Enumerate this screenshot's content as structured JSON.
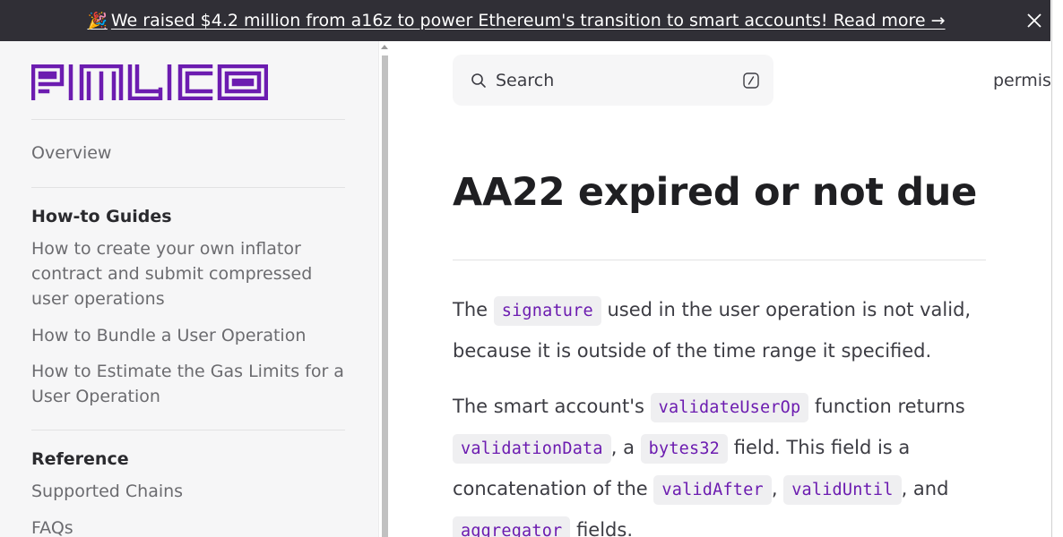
{
  "banner": {
    "emoji": "🎉",
    "text": "We raised $4.2 million from a16z to power Ethereum's transition to smart accounts! Read more →"
  },
  "brand": {
    "logo_text": "PIMLICO",
    "accent": "#6c1cb0"
  },
  "sidebar": {
    "overview": "Overview",
    "sections": [
      {
        "heading": "How-to Guides",
        "items": [
          "How to create your own inflator contract and submit compressed user operations",
          "How to Bundle a User Operation",
          "How to Estimate the Gas Limits for a User Operation"
        ]
      },
      {
        "heading": "Reference",
        "items": [
          "Supported Chains",
          "FAQs"
        ]
      }
    ]
  },
  "search": {
    "label": "Search"
  },
  "top_nav": {
    "partial_item": "permis"
  },
  "article": {
    "title": "AA22 expired or not due",
    "p1": {
      "t1": "The",
      "code1": "signature",
      "t2": "used in the user operation is not valid, because it is outside of the time range it specified."
    },
    "p2": {
      "t1": "The smart account's",
      "code1": "validateUserOp",
      "t2": "function returns",
      "code2": "validationData",
      "t3": ", a",
      "code3": "bytes32",
      "t4": "field. This field is a concatenation of the",
      "code4": "validAfter",
      "t5": ",",
      "code5": "validUntil",
      "t6": ", and",
      "code6": "aggregator",
      "t7": "fields."
    }
  },
  "icons": {
    "banner_close": "close-icon",
    "search": "search-icon",
    "search_shortcut": "slash-key-icon"
  }
}
